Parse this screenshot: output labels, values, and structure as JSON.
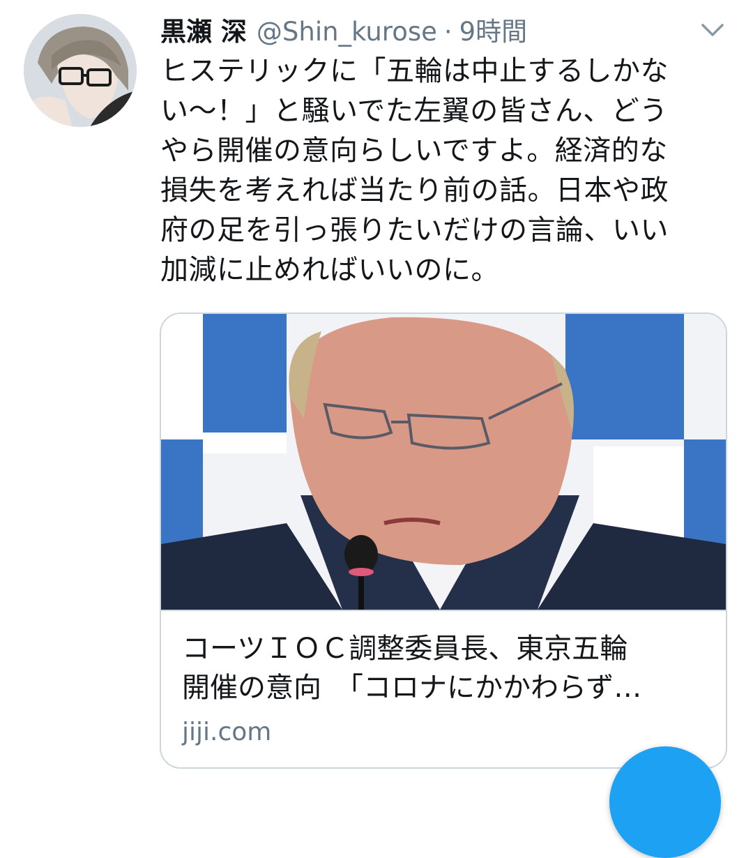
{
  "tweet": {
    "display_name": "黒瀬 深",
    "handle": "@Shin_kurose",
    "separator": "·",
    "timestamp": "9時間",
    "text": "ヒステリックに「五輪は中止するしかな\nい〜！」と騒いでた左翼の皆さん、どう\nやら開催の意向らしいですよ。経済的な\n損失を考えれば当たり前の話。日本や政\n府の足を引っ張りたいだけの言論、いい\n加減に止めればいいのに。"
  },
  "card": {
    "title": "コーツＩＯＣ調整委員長、東京五輪\n開催の意向　「コロナにかかわらず…",
    "domain": "jiji.com"
  },
  "icons": {
    "menu": "chevron-down-icon",
    "compose": "compose-fab"
  },
  "colors": {
    "accent": "#1da1f2",
    "secondary_text": "#657786",
    "border": "#ccd6dd"
  }
}
